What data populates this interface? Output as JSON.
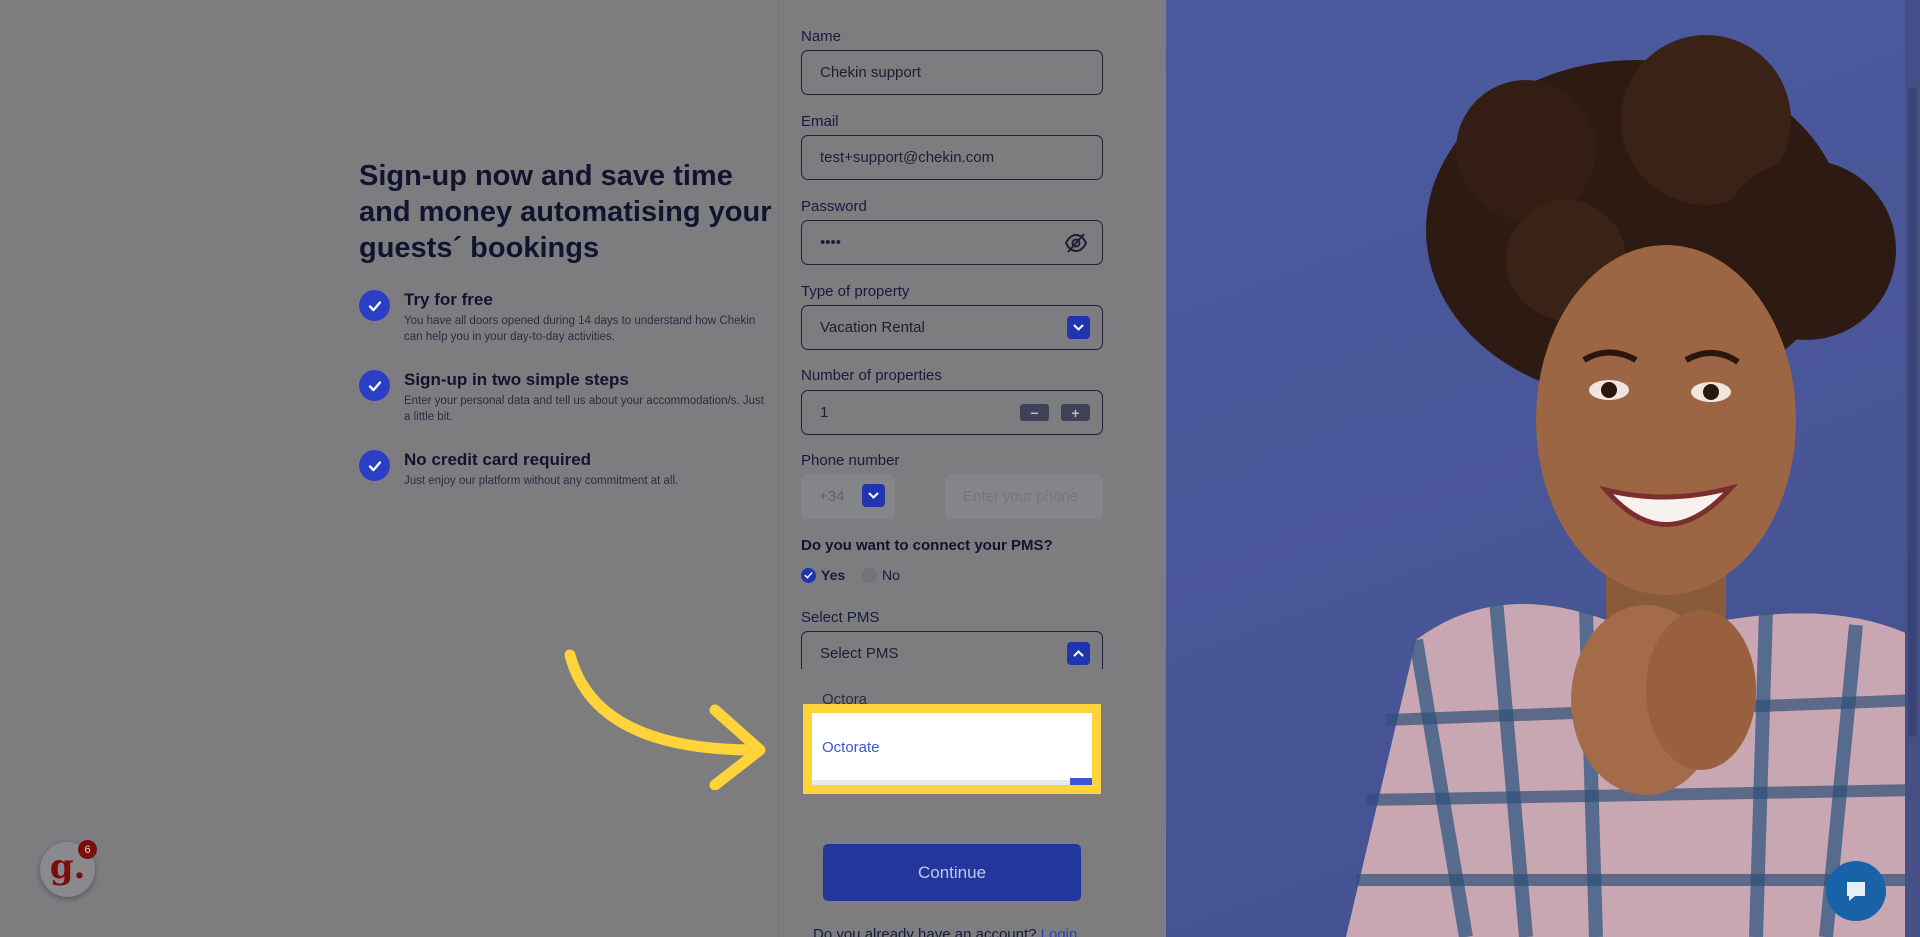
{
  "marketing": {
    "headline": "Sign-up now and save time and money automatising your guests´ bookings",
    "features": [
      {
        "title": "Try for free",
        "desc": "You have all doors opened during 14 days to understand how Chekin can help you in your day-to-day activities."
      },
      {
        "title": "Sign-up in two simple steps",
        "desc": "Enter your personal data and tell us about your accommodation/s. Just a little bit."
      },
      {
        "title": "No credit card required",
        "desc": "Just enjoy our platform without any commitment at all."
      }
    ]
  },
  "form": {
    "name": {
      "label": "Name",
      "value": "Chekin support"
    },
    "email": {
      "label": "Email",
      "value": "test+support@chekin.com"
    },
    "password": {
      "label": "Password",
      "value": "••••"
    },
    "property_type": {
      "label": "Type of property",
      "value": "Vacation Rental"
    },
    "num_properties": {
      "label": "Number of properties",
      "value": "1",
      "minus": "−",
      "plus": "+"
    },
    "phone": {
      "label": "Phone number",
      "code": "+34",
      "placeholder": "Enter your phone"
    },
    "pms_question": "Do you want to connect your PMS?",
    "pms_yes": "Yes",
    "pms_no": "No",
    "pms_select": {
      "label": "Select PMS",
      "value": "Select PMS"
    },
    "dropdown": {
      "partial_option": "Octora",
      "highlighted_option": "Octorate"
    },
    "continue": "Continue",
    "already_text": "Do you already have an account?",
    "login_link": "Login"
  },
  "widgets": {
    "gleap_logo": "g.",
    "gleap_count": "6"
  },
  "colors": {
    "primary": "#1f35b0",
    "highlight": "#ffd43a",
    "option_link": "#3b54d9",
    "photo_bg": "#4a579a"
  }
}
